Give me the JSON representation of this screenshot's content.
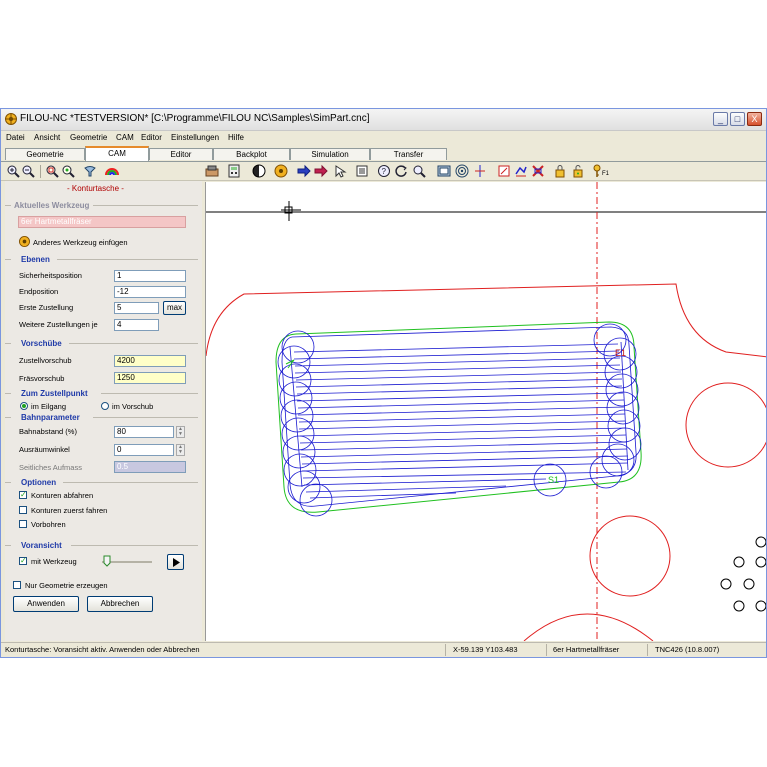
{
  "window": {
    "title": "FILOU-NC  *TESTVERSION*  [C:\\Programme\\FILOU NC\\Samples\\SimPart.cnc]",
    "controls": [
      "_",
      "□",
      "X"
    ]
  },
  "menu": [
    "Datei",
    "Ansicht",
    "Geometrie",
    "CAM",
    "Editor",
    "Einstellungen",
    "Hilfe"
  ],
  "tabs": [
    "Geometrie",
    "CAM",
    "Editor",
    "Backplot",
    "Simulation",
    "Transfer"
  ],
  "toolbar": {
    "icons": [
      "zoom-in-icon",
      "zoom-out-icon",
      "zoom-window-icon",
      "zoom-all-icon",
      "view-icon",
      "color-icon",
      "settings-icon",
      "calculator-icon",
      "tool-sphere-icon",
      "tool-icon",
      "arrow-right-icon",
      "arrow-icon",
      "pointer-icon",
      "list-icon",
      "help-icon",
      "circle-icon",
      "zoom-prev-icon",
      "grid-icon",
      "target-icon",
      "crosshair-icon",
      "layer-icon",
      "layer-edit-icon",
      "layer-delete-icon",
      "lock-icon",
      "unlock-icon",
      "key-icon"
    ],
    "f1_label": "F1"
  },
  "panel": {
    "heading": "- Konturtasche -",
    "sections": {
      "tool": "Aktuelles Werkzeug",
      "levels": "Ebenen",
      "feeds": "Vorschübe",
      "approach": "Zum Zustellpunkt",
      "path": "Bahnparameter",
      "options": "Optionen",
      "preview": "Voransicht"
    },
    "tool_value": "6er Hartmetallfräser",
    "insert_tool": "Anderes Werkzeug einfügen",
    "fields": {
      "safety_label": "Sicherheitsposition",
      "safety_value": "1",
      "end_label": "Endposition",
      "end_value": "-12",
      "first_label": "Erste Zustellung",
      "first_value": "5",
      "max_label": "max",
      "further_label": "Weitere Zustellungen je",
      "further_value": "4",
      "infeed_label": "Zustellvorschub",
      "infeed_value": "4200",
      "milling_label": "Fräsvorschub",
      "milling_value": "1250",
      "stepover_label": "Bahnabstand (%)",
      "stepover_value": "80",
      "angle_label": "Ausräumwinkel",
      "angle_value": "0",
      "side_label": "Seitliches Aufmass",
      "side_value": "0.5"
    },
    "radios": {
      "rapid": "im Eilgang",
      "feed": "im Vorschub",
      "selected": "rapid"
    },
    "checks": {
      "contour_trace": "Konturen abfahren",
      "contour_trace_on": true,
      "contour_first": "Konturen zuerst fahren",
      "contour_first_on": false,
      "predrill": "Vorbohren",
      "predrill_on": false,
      "with_tool": "mit Werkzeug",
      "with_tool_on": true,
      "geometry_only": "Nur Geometrie erzeugen",
      "geometry_only_on": false
    },
    "slider_level": 0.05,
    "apply": "Anwenden",
    "cancel": "Abbrechen"
  },
  "canvas": {
    "label_e1": "E1",
    "label_s1": "S1",
    "colors": {
      "geometry": "#e02020",
      "toolpath": "#1a1ad0",
      "contour": "#20c020"
    }
  },
  "status": {
    "message": "Konturtasche: Voransicht aktiv. Anwenden oder Abbrechen",
    "coords": "X-59.139 Y103.483",
    "tool": "6er Hartmetallfräser",
    "control": "TNC426  (10.8.007)"
  }
}
